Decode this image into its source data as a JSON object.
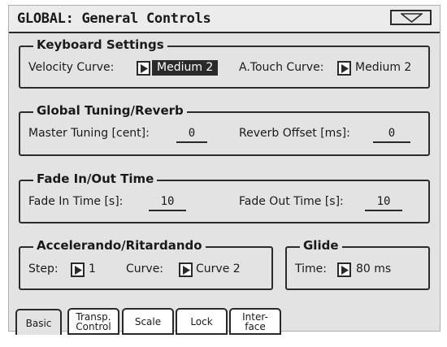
{
  "window": {
    "title": "GLOBAL: General Controls",
    "menu_icon": "triangle-down-icon"
  },
  "keyboard": {
    "legend": "Keyboard Settings",
    "velocity_label": "Velocity Curve:",
    "velocity_value": "Medium 2",
    "atouch_label": "A.Touch Curve:",
    "atouch_value": "Medium 2"
  },
  "tuning": {
    "legend": "Global Tuning/Reverb",
    "master_label": "Master Tuning [cent]:",
    "master_value": "0",
    "reverb_label": "Reverb Offset [ms]:",
    "reverb_value": "0"
  },
  "fade": {
    "legend": "Fade In/Out Time",
    "in_label": "Fade In Time [s]:",
    "in_value": "10",
    "out_label": "Fade Out Time [s]:",
    "out_value": "10"
  },
  "accel": {
    "legend": "Accelerando/Ritardando",
    "step_label": "Step:",
    "step_value": "1",
    "curve_label": "Curve:",
    "curve_value": "Curve 2"
  },
  "glide": {
    "legend": "Glide",
    "time_label": "Time:",
    "time_value": "80 ms"
  },
  "tabs": [
    {
      "line1": "Basic",
      "line2": ""
    },
    {
      "line1": "Transp.",
      "line2": "Control"
    },
    {
      "line1": "Scale",
      "line2": ""
    },
    {
      "line1": "Lock",
      "line2": ""
    },
    {
      "line1": "Inter-",
      "line2": "face"
    }
  ],
  "active_tab": "Basic",
  "colors": {
    "background": "#e3e3e3",
    "selected": "#2a2a2a",
    "border": "#2a2a2a"
  }
}
